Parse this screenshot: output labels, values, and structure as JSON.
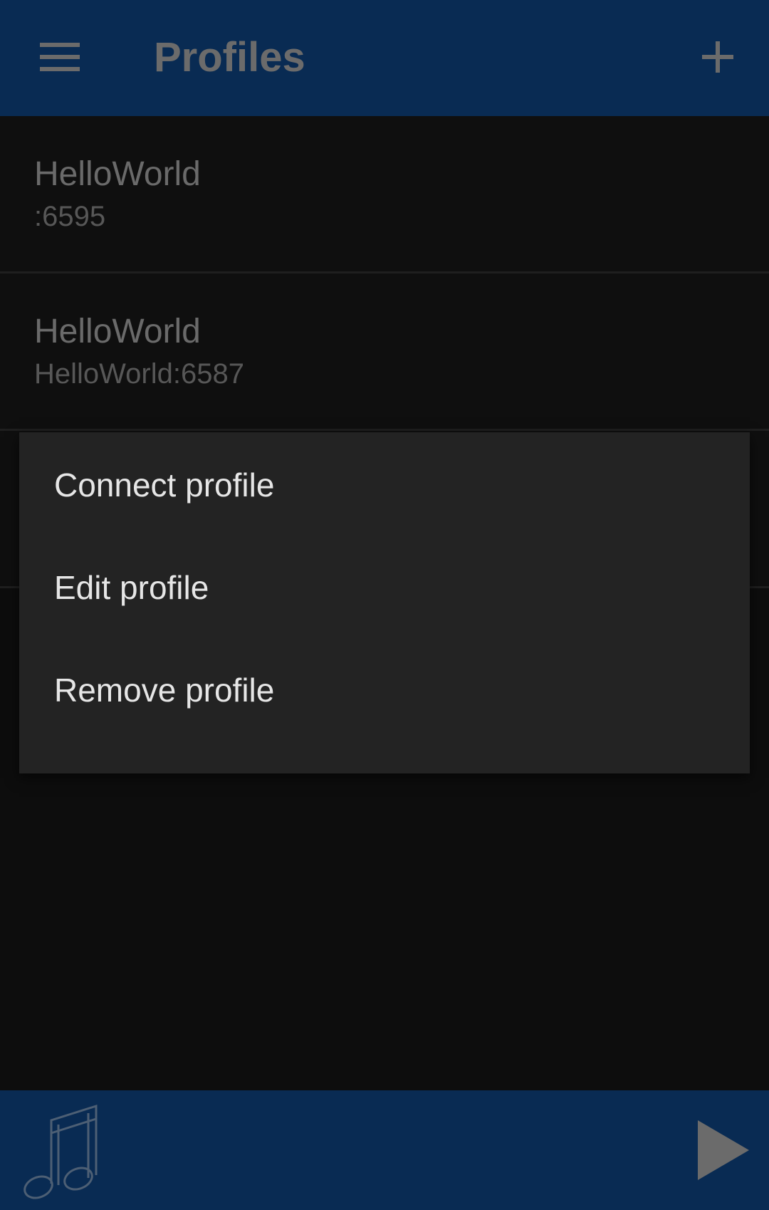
{
  "app_bar": {
    "title": "Profiles",
    "menu_icon": "hamburger-menu-icon",
    "add_icon": "plus-icon"
  },
  "profiles": [
    {
      "name": "HelloWorld",
      "detail": ":6595"
    },
    {
      "name": "HelloWorld",
      "detail": "HelloWorld:6587"
    }
  ],
  "context_menu": {
    "items": [
      {
        "label": "Connect profile"
      },
      {
        "label": "Edit profile"
      },
      {
        "label": "Remove profile"
      }
    ]
  },
  "bottom_bar": {
    "music_icon": "music-note-icon",
    "play_icon": "play-icon"
  },
  "colors": {
    "app_bar": "#092b53",
    "background": "#0d0d0d",
    "menu_background": "#232323",
    "menu_text": "#e6e6e6",
    "dim_text": "#6b6b6b"
  }
}
